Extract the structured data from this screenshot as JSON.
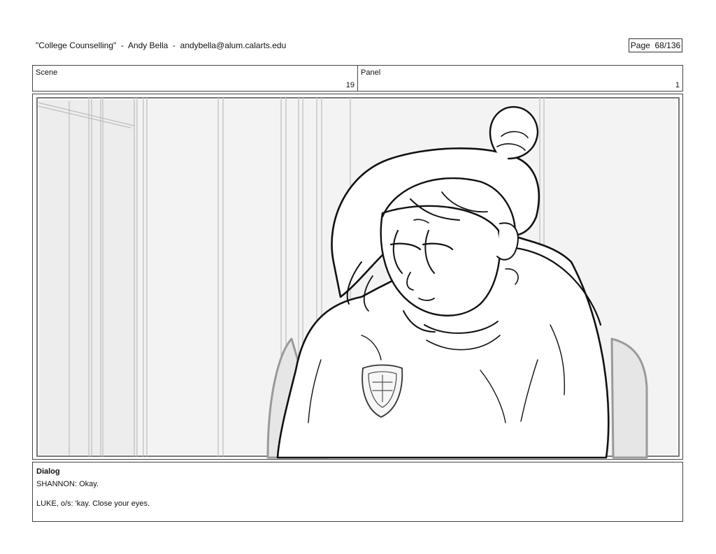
{
  "header": {
    "title": "\"College Counselling\"",
    "author": "Andy Bella",
    "email": "andybella@alum.calarts.edu",
    "separator": "  -  ",
    "page_label": "Page  68/136"
  },
  "scene": {
    "label": "Scene",
    "number": "19"
  },
  "panel": {
    "label": "Panel",
    "number": "1"
  },
  "dialog": {
    "title": "Dialog",
    "lines": [
      "SHANNON: Okay.",
      "LUKE, o/s: 'kay. Close your eyes."
    ]
  }
}
